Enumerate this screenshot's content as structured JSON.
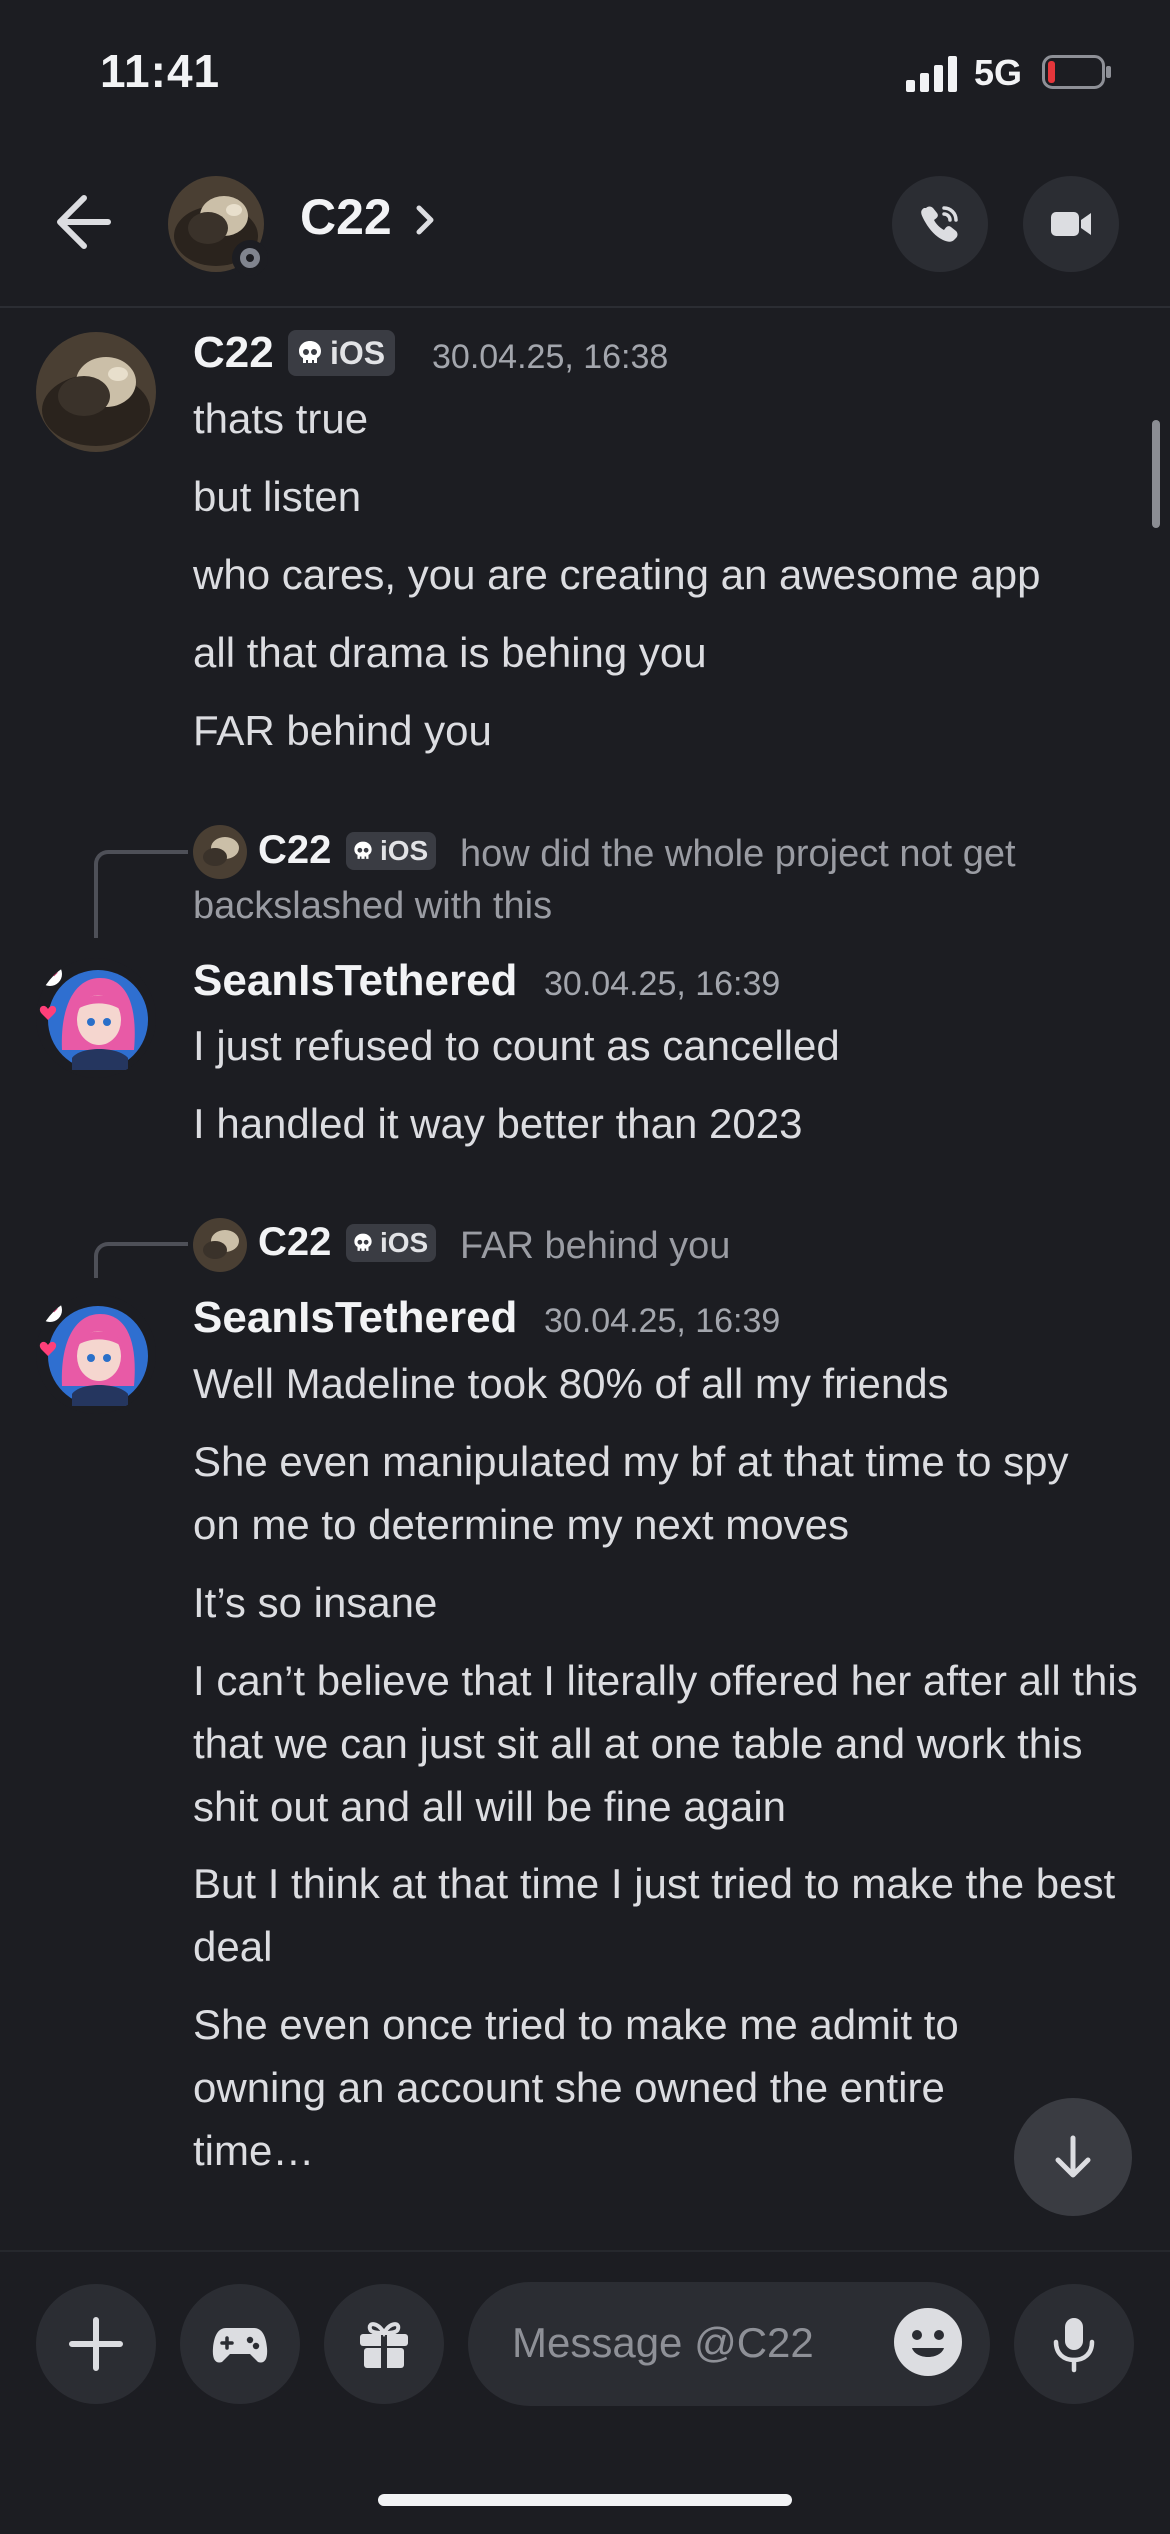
{
  "status_bar": {
    "time": "11:41",
    "network": "5G"
  },
  "header": {
    "title": "C22",
    "chevron": "›"
  },
  "icons": {
    "back": "arrow-left-icon",
    "call": "phone-call-icon",
    "video": "video-camera-icon",
    "skull": "skull-icon",
    "jump": "arrow-down-icon",
    "add": "plus-icon",
    "games": "gamepad-icon",
    "gift": "gift-icon",
    "emoji": "emoji-icon",
    "mic": "microphone-icon"
  },
  "colors": {
    "background": "#1c1d22",
    "surface": "#2b2d33",
    "muted_text": "#a3a6ad",
    "battery_low": "#e5363b"
  },
  "messages": {
    "group1": {
      "username": "C22",
      "tag": "iOS",
      "timestamp": "30.04.25, 16:38",
      "lines": [
        "thats true",
        "but listen",
        "who cares, you are creating an awesome app",
        "all that drama is behing you",
        "FAR behind you"
      ]
    },
    "group2": {
      "reply": {
        "username": "C22",
        "tag": "iOS",
        "text_line1": "how did the whole project not get",
        "text_line2": "backslashed with this"
      },
      "username": "SeanIsTethered",
      "timestamp": "30.04.25, 16:39",
      "lines": [
        "I just refused to count as cancelled",
        "I handled it way better than 2023"
      ]
    },
    "group3": {
      "reply": {
        "username": "C22",
        "tag": "iOS",
        "text": "FAR behind you"
      },
      "username": "SeanIsTethered",
      "timestamp": "30.04.25, 16:39",
      "lines": [
        "Well Madeline took 80% of all my friends",
        "She even manipulated my bf at that time to spy on me to determine my next moves",
        "It’s so insane",
        "I can’t believe that I literally offered her after all this that we can just sit all at one table and work this shit out and all will be fine again",
        "But I think at that time I just tried to make the best deal",
        "She even once tried to make me admit to owning an account she owned the entire time…"
      ]
    }
  },
  "composer": {
    "placeholder": "Message @C22"
  }
}
